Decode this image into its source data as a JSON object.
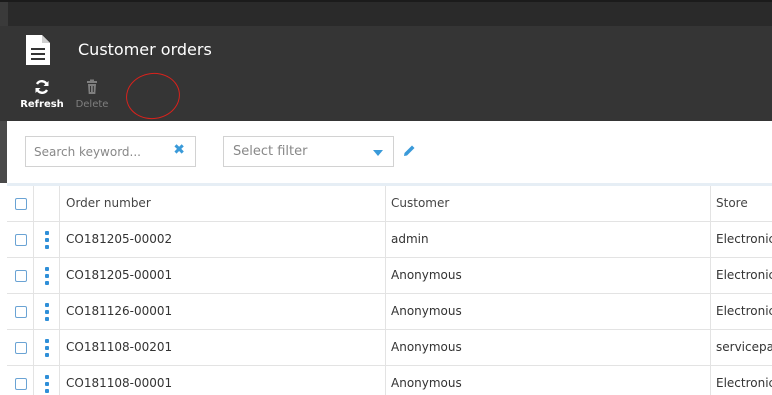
{
  "header": {
    "title": "Customer orders"
  },
  "toolbar": {
    "refresh_label": "Refresh",
    "delete_label": "Delete"
  },
  "filters": {
    "search_placeholder": "Search keyword...",
    "select_value": "Select filter"
  },
  "table": {
    "columns": [
      "Order number",
      "Customer",
      "Store"
    ],
    "rows": [
      {
        "order": "CO181205-00002",
        "customer": "admin",
        "store": "Electronic"
      },
      {
        "order": "CO181205-00001",
        "customer": "Anonymous",
        "store": "Electronic"
      },
      {
        "order": "CO181126-00001",
        "customer": "Anonymous",
        "store": "Electronic"
      },
      {
        "order": "CO181108-00201",
        "customer": "Anonymous",
        "store": "servicepa"
      },
      {
        "order": "CO181108-00001",
        "customer": "Anonymous",
        "store": "Electronic"
      }
    ]
  },
  "colors": {
    "header_bg": "#353535",
    "accent": "#3a9ad9",
    "annotation": "#d8221c"
  }
}
